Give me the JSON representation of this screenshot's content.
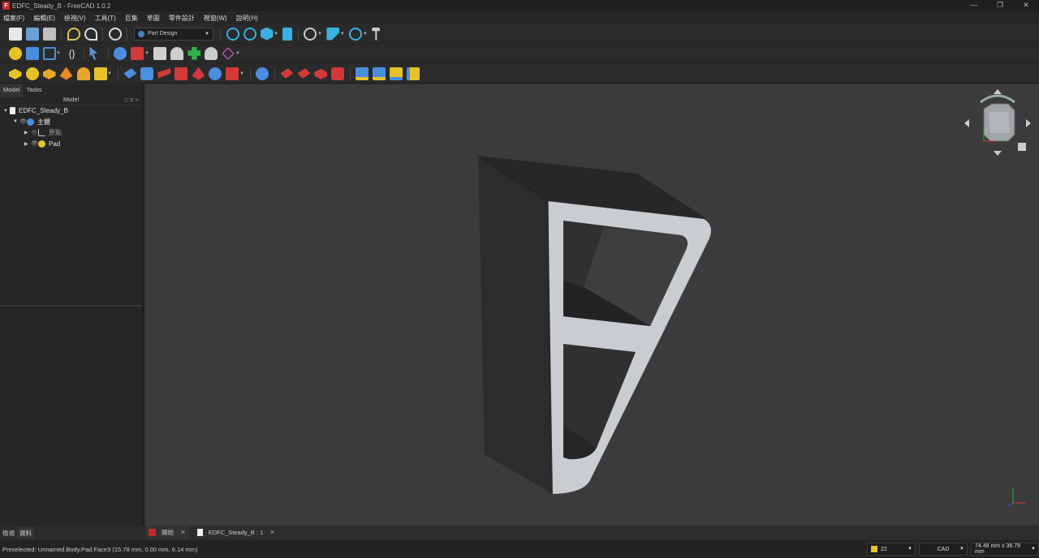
{
  "window": {
    "title": "EDFC_Steady_B - FreeCAD 1.0.2",
    "app_icon": "F",
    "controls": [
      "—",
      "❐",
      "✕"
    ]
  },
  "menu": [
    "檔案(F)",
    "編輯(E)",
    "檢視(V)",
    "工具(T)",
    "巨集",
    "草圖",
    "零件設計",
    "視窗(W)",
    "說明(H)"
  ],
  "toolbar": {
    "workbench_label": "Part Design"
  },
  "model_panel": {
    "tabs": [
      "Model",
      "Tasks"
    ],
    "header": "Model",
    "tree": [
      {
        "label": "EDFC_Steady_B",
        "icon": "document-icon",
        "level": 0
      },
      {
        "label": "主體",
        "icon": "body-icon",
        "level": 1
      },
      {
        "label": "原點",
        "icon": "origin-icon",
        "level": 2
      },
      {
        "label": "Pad",
        "icon": "pad-icon",
        "level": 2
      }
    ]
  },
  "bottom_tabs": [
    "檢視",
    "資料"
  ],
  "doc_tabs": [
    {
      "label": "開始",
      "icon": "freecad-icon"
    },
    {
      "label": "EDFC_Steady_B : 1",
      "icon": "document-icon"
    }
  ],
  "status": {
    "message": "Preselected: Unnamed.Body.Pad.Face3 (15.78 mm, 0.00 mm, 6.14 mm)",
    "draw_style_value": "22",
    "nav_style": "CAD",
    "dimensions": "74.48 mm x 36.79 mm"
  },
  "colors": {
    "viewport_bg": "#3b3b3b",
    "part_dark": "#2b2b2b",
    "part_face": "#c9ccd0"
  }
}
